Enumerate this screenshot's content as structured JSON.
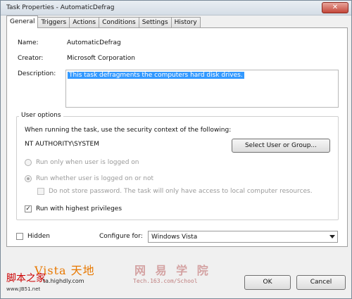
{
  "window": {
    "title": "Task Properties - AutomaticDefrag",
    "close_glyph": "✕"
  },
  "tabs": [
    "General",
    "Triggers",
    "Actions",
    "Conditions",
    "Settings",
    "History"
  ],
  "general": {
    "name_label": "Name:",
    "name_value": "AutomaticDefrag",
    "creator_label": "Creator:",
    "creator_value": "Microsoft Corporation",
    "description_label": "Description:",
    "description_value": "This task defragments the computers hard disk drives."
  },
  "user_options": {
    "title": "User options",
    "context_text": "When running the task, use the security context of the following:",
    "account": "NT AUTHORITY\\SYSTEM",
    "select_button": "Select User or Group...",
    "radio_logged_on": "Run only when user is logged on",
    "radio_whether": "Run whether user is logged on or not",
    "no_store_password": "Do not store password.  The task will only have access to local computer resources.",
    "highest_privileges": "Run with highest privileges",
    "highest_privileges_checked": true
  },
  "bottom": {
    "hidden_label": "Hidden",
    "configure_label": "Configure for:",
    "configure_value": "Windows Vista"
  },
  "buttons": {
    "ok": "OK",
    "cancel": "Cancel"
  },
  "watermarks": {
    "vista": "Vista 天地",
    "wangyi": "网 易 学 院",
    "tech": "Tech.163.com/School",
    "jiaoben": "脚本之家",
    "highdly": "ta.highdly.com",
    "jb51": "www.JB51.net"
  },
  "icons": {
    "check_mark": "✓"
  }
}
